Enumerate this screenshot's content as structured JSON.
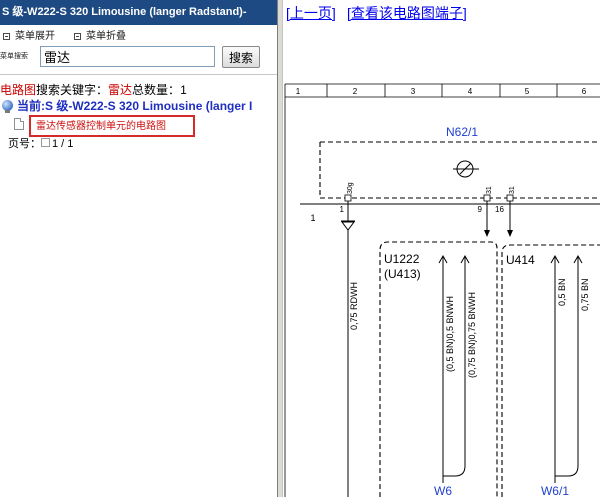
{
  "sidebar": {
    "title": "S 级-W222-S 320 Limousine (langer Radstand)-",
    "menu": {
      "expand_label": "菜单展开",
      "collapse_label": "菜单折叠"
    },
    "search": {
      "label": "菜单搜索",
      "value": "雷达",
      "button": "搜索"
    },
    "results": {
      "category": "电路图",
      "keyword_label": "搜索关键字：",
      "keyword": "雷达",
      "count_label": "总数量：",
      "count": "1"
    },
    "tree": {
      "root_label": "当前:S 级-W222-S 320 Limousine (langer I",
      "child_label": "雷达传感器控制单元的电路图"
    },
    "pagination": {
      "label": "页号：",
      "value": "1 / 1"
    }
  },
  "viewer": {
    "prev_link": "[上一页]",
    "terminals_link": "[查看该电路图端子]",
    "ruler": [
      "1",
      "2",
      "3",
      "4",
      "5",
      "6"
    ],
    "diagram": {
      "component": "N62/1",
      "pins": [
        "30g",
        "31",
        "31"
      ],
      "pin_numbers": [
        "1",
        "9",
        "16"
      ],
      "left_marker": "1",
      "wire_rdwh": "0,75 RDWH",
      "block_a": {
        "name": "U1222",
        "alt": "(U413)",
        "wires": [
          "(0,5 BN)0,5 BNWH",
          "(0,75 BN)0,75 BNWH"
        ],
        "target": "W6"
      },
      "block_b": {
        "name": "U414",
        "wires": [
          "0,5 BN",
          "0,75 BN"
        ],
        "target": "W6/1"
      }
    }
  },
  "icons": {
    "expand": "expand-icon",
    "collapse": "collapse-icon",
    "tree_root": "globe-icon",
    "tree_child": "document-icon",
    "component": "sensor-symbol-icon"
  },
  "colors": {
    "title_bar": "#1d4a82",
    "link": "#0000ee",
    "highlight_border": "#d42a2a",
    "keyword_red": "#cc0000",
    "tree_root_text": "#1f2fbf",
    "diagram_label_blue": "#1f3fd0"
  }
}
